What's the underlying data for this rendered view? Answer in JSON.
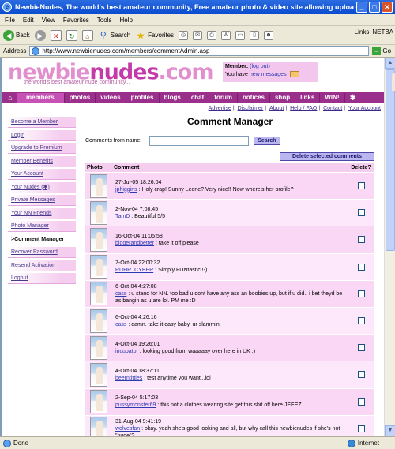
{
  "window": {
    "title": "NewbieNudes, The world's best amateur community, Free amateur photo & video site allowing uploa - Microsoft I...",
    "minimize": "_",
    "maximize": "□",
    "close": "✕"
  },
  "menu": [
    "File",
    "Edit",
    "View",
    "Favorites",
    "Tools",
    "Help"
  ],
  "toolbar": {
    "back": "Back",
    "search": "Search",
    "favorites": "Favorites",
    "links": "Links",
    "netbar": "NETBA"
  },
  "address": {
    "label": "Address",
    "url": "http://www.newbienudes.com/members/commentAdmin.asp",
    "go": "Go"
  },
  "site": {
    "logo_part1": "newbie",
    "logo_part2": "nudes",
    "logo_part3": ".com",
    "tagline": "the world's best amateur nude community...",
    "member_label": "Member:",
    "logout": "(log out)",
    "you_have": "You have",
    "new_messages": "new messages"
  },
  "nav": {
    "home_icon": "⌂",
    "items": [
      "members",
      "photos",
      "videos",
      "profiles",
      "blogs",
      "chat",
      "forum",
      "notices",
      "shop",
      "links",
      "WIN!"
    ],
    "end_icon": "✱"
  },
  "sublinks": [
    "Advertise",
    "Disclaimer",
    "About",
    "Help / FAQ",
    "Contact",
    "Your Account"
  ],
  "sidebar": [
    "Become a Member",
    "Login",
    "Upgrade to Premium",
    "Member Benefits",
    "Your Account",
    "Your Nudes (✱)",
    "Private Messages",
    "Your NN Friends",
    "Photo Manager",
    ">Comment Manager",
    "Recover Password",
    "Resend Activation",
    "Logout"
  ],
  "main": {
    "title": "Comment Manager",
    "filter_label": "Comments from name:",
    "filter_value": "",
    "search_button": "Search",
    "delete_button": "Delete selected comments",
    "col_photo": "Photo",
    "col_comment": "Comment",
    "col_delete": "Delete?"
  },
  "comments": [
    {
      "date": "27-Jul-05 18:26:04",
      "user": "jphiggins",
      "text": " : Holy crap! Sunny Leone? Very nice!! Now where's her profile?"
    },
    {
      "date": "2-Nov-04 7:08:45",
      "user": "TamD",
      "text": " : Beautiful 5/5"
    },
    {
      "date": "16-Oct-04 11:05:58",
      "user": "biggerandbetter",
      "text": " : take it off please"
    },
    {
      "date": "7-Oct-04 22:00:32",
      "user": "RUHR_CYBER",
      "text": " : Simply FUNtastic !-)"
    },
    {
      "date": "6-Oct-04 4:27:08",
      "user": "cass",
      "text": " : u stand for NN. too bad u dont have any ass an boobies up, but if u did.. i bet theyd be as bangin as u are lol. PM me :D"
    },
    {
      "date": "6-Oct-04 4:26:16",
      "user": "cass",
      "text": " : damn. take it easy baby, ur slammin."
    },
    {
      "date": "4-Oct-04 19:26:01",
      "user": "incubator",
      "text": " : looking good from waaaaay over here in UK :)"
    },
    {
      "date": "4-Oct-04 18:37:11",
      "user": "beerntitties",
      "text": " : test anytime you want...lol"
    },
    {
      "date": "2-Sep-04 5:17:03",
      "user": "pussymonster69",
      "text": " : this not a clothes wearing site get this shit off here JEEEZ"
    },
    {
      "date": "31-Aug-04 9:41:19",
      "user": "wolvesfan",
      "text": " : okay. yeah she's good looking and all, but why call this newbienudes if she's not \"nude\"?"
    }
  ],
  "status": {
    "left": "Done",
    "right": "Internet"
  }
}
